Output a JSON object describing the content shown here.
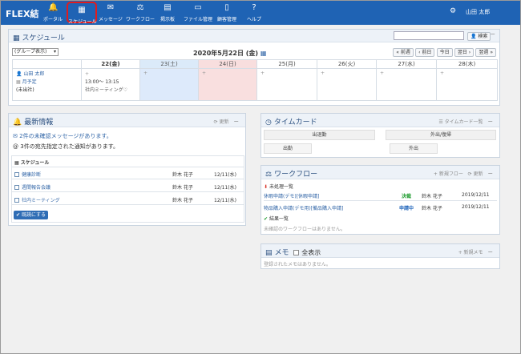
{
  "header": {
    "logo": "FLEX結",
    "user_name": "山田 太郎",
    "nav": [
      {
        "label": "ポータル",
        "icon": "🔔"
      },
      {
        "label": "スケジュール",
        "icon": "▦"
      },
      {
        "label": "メッセージ",
        "icon": "✉"
      },
      {
        "label": "ワークフロー",
        "icon": "⚖"
      },
      {
        "label": "掲示板",
        "icon": "▤"
      },
      {
        "label": "ファイル管理",
        "icon": "▭"
      },
      {
        "label": "顧客管理",
        "icon": "▯"
      },
      {
        "label": "ヘルプ",
        "icon": "?"
      }
    ]
  },
  "schedule": {
    "title": "スケジュール",
    "search_label": "検索",
    "group_select": "(グループ表示)",
    "date": "2020年5月22日 (金)",
    "nav_buttons": [
      "« 前週",
      "‹ 前日",
      "今日",
      "翌日 ›",
      "翌週 »"
    ],
    "days": [
      "22(金)",
      "23(土)",
      "24(日)",
      "25(月)",
      "26(火)",
      "27(水)",
      "28(木)"
    ],
    "user": {
      "name": "山田 太郎",
      "plan_label": "月予定",
      "status": "(未出社)"
    },
    "event": {
      "time": "13:00～ 13:15",
      "title": "社内ミーティング"
    }
  },
  "news": {
    "title": "最新情報",
    "refresh": "更新",
    "unread_msg": "2件の未確認メッセージがあります。",
    "unread_notice": "3件の宛先指定された通知があります。",
    "section": "スケジュール",
    "items": [
      {
        "title": "健康診断",
        "user": "鈴木 花子",
        "date": "12/11(水)"
      },
      {
        "title": "週間報告会議",
        "user": "鈴木 花子",
        "date": "12/11(水)"
      },
      {
        "title": "社内ミーティング",
        "user": "鈴木 花子",
        "date": "12/11(水)"
      }
    ],
    "confirm_button": "既読にする"
  },
  "timecard": {
    "title": "タイムカード",
    "list_link": "タイムカード一覧",
    "col1": "出退勤",
    "col2": "外出/復帰",
    "btn_in": "出勤",
    "btn_out": "外出"
  },
  "workflow": {
    "title": "ワークフロー",
    "new_link": "新規フロー",
    "refresh": "更新",
    "unprocessed": "未処理一覧",
    "items": [
      {
        "title": "休暇申請(デモ)[休暇申請]",
        "status": "決裁",
        "status_color": "#1a9a2a",
        "user": "鈴木 花子",
        "date": "2019/12/11"
      },
      {
        "title": "物品購入申請(デモ用)[備品購入申請]",
        "status": "申請中",
        "status_color": "#2266bb",
        "user": "鈴木 花子",
        "date": "2019/12/11"
      }
    ],
    "done": "結果一覧",
    "empty": "未確認のワークフローはありません。"
  },
  "memo": {
    "title": "メモ",
    "show_all": "全表示",
    "new_link": "新規メモ",
    "empty": "登録されたメモはありません。"
  }
}
